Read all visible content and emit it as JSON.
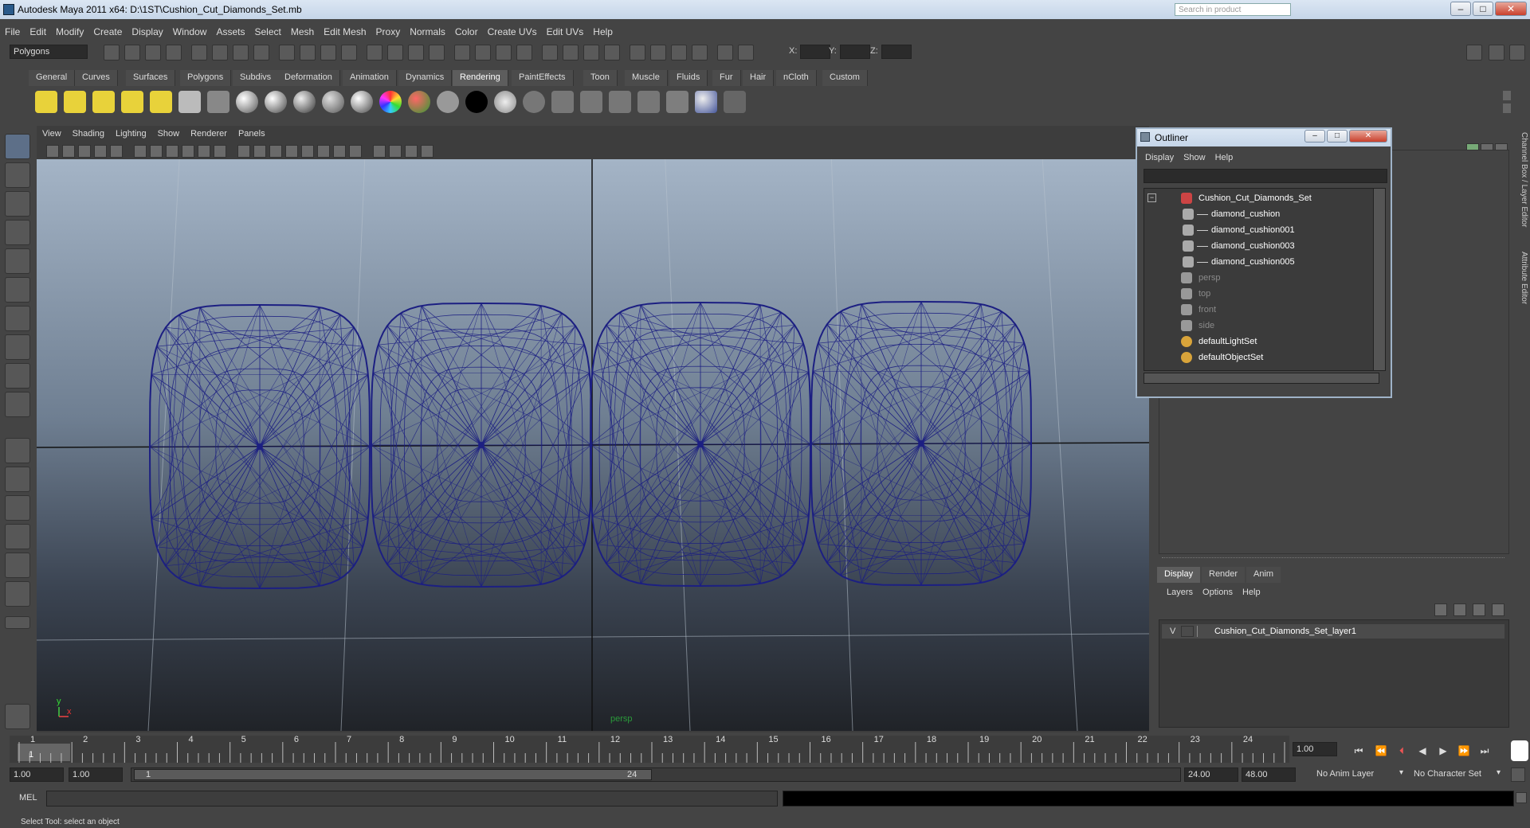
{
  "window": {
    "title": "Autodesk Maya 2011 x64: D:\\1ST\\Cushion_Cut_Diamonds_Set.mb",
    "search_placeholder": "Search in product"
  },
  "menus": [
    "File",
    "Edit",
    "Modify",
    "Create",
    "Display",
    "Window",
    "Assets",
    "Select",
    "Mesh",
    "Edit Mesh",
    "Proxy",
    "Normals",
    "Color",
    "Create UVs",
    "Edit UVs",
    "Help"
  ],
  "status_line": {
    "mode": "Polygons",
    "x_label": "X:",
    "y_label": "Y:",
    "z_label": "Z:"
  },
  "shelf_tabs": [
    "General",
    "Curves",
    "Surfaces",
    "Polygons",
    "Subdivs",
    "Deformation",
    "Animation",
    "Dynamics",
    "Rendering",
    "PaintEffects",
    "Toon",
    "Muscle",
    "Fluids",
    "Fur",
    "Hair",
    "nCloth",
    "Custom"
  ],
  "active_shelf_tab": "Rendering",
  "viewport": {
    "menus": [
      "View",
      "Shading",
      "Lighting",
      "Show",
      "Renderer",
      "Panels"
    ],
    "camera_label": "persp",
    "axis_y": "y",
    "axis_x": "x"
  },
  "outliner": {
    "title": "Outliner",
    "menus": [
      "Display",
      "Show",
      "Help"
    ],
    "items": [
      {
        "label": "Cushion_Cut_Diamonds_Set",
        "icon": "group-icon",
        "level": 0,
        "dim": false
      },
      {
        "label": "diamond_cushion",
        "icon": "mesh-icon",
        "level": 1,
        "dim": false
      },
      {
        "label": "diamond_cushion001",
        "icon": "mesh-icon",
        "level": 1,
        "dim": false
      },
      {
        "label": "diamond_cushion003",
        "icon": "mesh-icon",
        "level": 1,
        "dim": false
      },
      {
        "label": "diamond_cushion005",
        "icon": "mesh-icon",
        "level": 1,
        "dim": false
      },
      {
        "label": "persp",
        "icon": "camera-icon",
        "level": 0,
        "dim": true
      },
      {
        "label": "top",
        "icon": "camera-icon",
        "level": 0,
        "dim": true
      },
      {
        "label": "front",
        "icon": "camera-icon",
        "level": 0,
        "dim": true
      },
      {
        "label": "side",
        "icon": "camera-icon",
        "level": 0,
        "dim": true
      },
      {
        "label": "defaultLightSet",
        "icon": "set-icon",
        "level": 0,
        "dim": false
      },
      {
        "label": "defaultObjectSet",
        "icon": "set-icon",
        "level": 0,
        "dim": false
      }
    ]
  },
  "side_tabs": [
    "Channel Box / Layer Editor",
    "Attribute Editor"
  ],
  "layer_editor": {
    "tabs": [
      "Display",
      "Render",
      "Anim"
    ],
    "active_tab": "Display",
    "menus": [
      "Layers",
      "Options",
      "Help"
    ],
    "layer": {
      "visible": "V",
      "name": "Cushion_Cut_Diamonds_Set_layer1"
    }
  },
  "timeline": {
    "ticks": [
      "1",
      "2",
      "3",
      "4",
      "5",
      "6",
      "7",
      "8",
      "9",
      "10",
      "11",
      "12",
      "13",
      "14",
      "15",
      "16",
      "17",
      "18",
      "19",
      "20",
      "21",
      "22",
      "23",
      "24"
    ],
    "current_frame_label": "1",
    "current_time": "1.00"
  },
  "range": {
    "start": "1.00",
    "playback_start": "1.00",
    "slider_min": "1",
    "slider_max": "24",
    "playback_end": "24.00",
    "end": "48.00",
    "anim_layer": "No Anim Layer",
    "character_set": "No Character Set"
  },
  "command_line": {
    "label": "MEL"
  },
  "help_line": "Select Tool: select an object",
  "colors": {
    "wire": "#1c1f82",
    "accent": "#2a9a3a"
  }
}
